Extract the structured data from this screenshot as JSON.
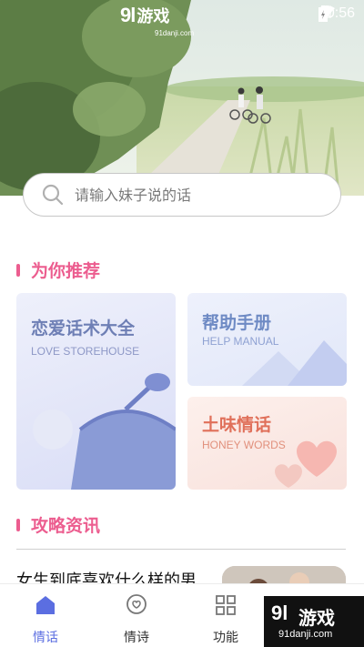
{
  "status_bar": {
    "time": "10:56"
  },
  "top_logo": {
    "number": "9l",
    "name": "游戏",
    "domain": "91danji.com"
  },
  "search": {
    "placeholder": "请输入妹子说的话"
  },
  "recommend": {
    "title": "为你推荐",
    "cards": [
      {
        "title": "恋爱话术大全",
        "subtitle": "LOVE STOREHOUSE",
        "title_color": "#6e7fb5"
      },
      {
        "title": "帮助手册",
        "subtitle": "HELP MANUAL",
        "title_color": "#6e8ac4"
      },
      {
        "title": "土味情话",
        "subtitle": "HONEY WORDS",
        "title_color": "#e0705a"
      }
    ]
  },
  "news": {
    "title": "攻略资讯",
    "article_title": "女生到底喜欢什么样的男"
  },
  "tabbar": {
    "tabs": [
      {
        "label": "情话",
        "icon": "home-icon",
        "active": true
      },
      {
        "label": "情诗",
        "icon": "heart-chat-icon",
        "active": false
      },
      {
        "label": "功能",
        "icon": "grid-icon",
        "active": false
      }
    ],
    "active_color": "#5b6ee1"
  },
  "watermark": {
    "number": "9l",
    "name": "游戏",
    "domain": "91danji.com"
  },
  "colors": {
    "accent_pink": "#ec5d8f"
  }
}
